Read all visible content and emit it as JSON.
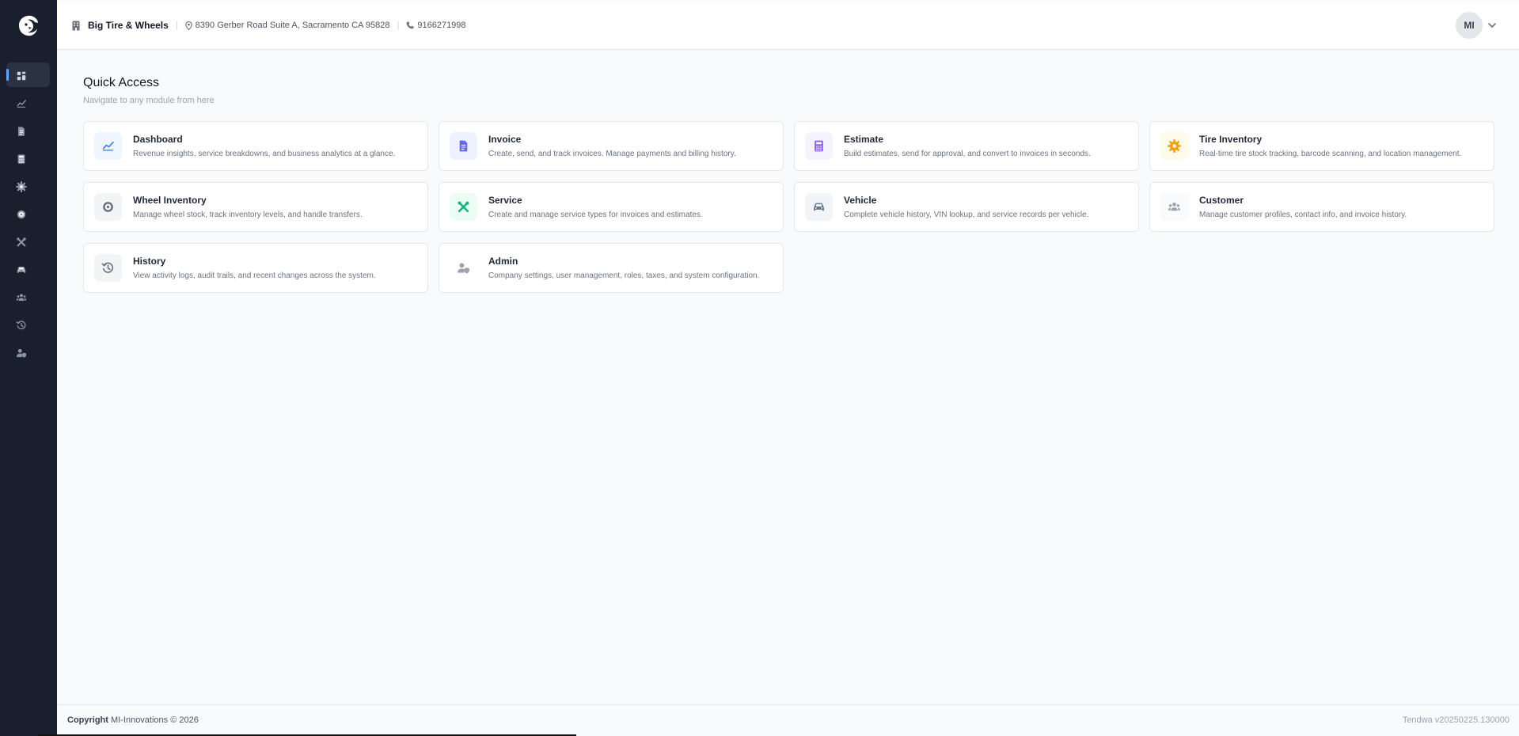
{
  "header": {
    "business_name": "Big Tire & Wheels",
    "address": "8390 Gerber Road Suite A, Sacramento CA 95828",
    "phone": "9166271998",
    "avatar_initials": "MI"
  },
  "sidebar": {
    "items": [
      {
        "name": "dashboard",
        "icon": "grid-icon",
        "active": true
      },
      {
        "name": "analytics",
        "icon": "chart-line-icon"
      },
      {
        "name": "invoice",
        "icon": "document-icon"
      },
      {
        "name": "estimate",
        "icon": "calculator-icon"
      },
      {
        "name": "tire-inventory",
        "icon": "gear-icon"
      },
      {
        "name": "wheel-inventory",
        "icon": "wheel-icon"
      },
      {
        "name": "service",
        "icon": "tools-icon"
      },
      {
        "name": "vehicle",
        "icon": "car-icon"
      },
      {
        "name": "customer",
        "icon": "users-icon"
      },
      {
        "name": "history",
        "icon": "history-icon"
      },
      {
        "name": "admin",
        "icon": "user-shield-icon"
      }
    ]
  },
  "main": {
    "title": "Quick Access",
    "subtitle": "Navigate to any module from here",
    "cards": [
      {
        "title": "Dashboard",
        "desc": "Revenue insights, service breakdowns, and business analytics at a glance.",
        "icon": "chart-line-icon",
        "color": "#3b82f6",
        "bg": "#eff6ff"
      },
      {
        "title": "Invoice",
        "desc": "Create, send, and track invoices. Manage payments and billing history.",
        "icon": "document-icon",
        "color": "#6366f1",
        "bg": "#eef2ff"
      },
      {
        "title": "Estimate",
        "desc": "Build estimates, send for approval, and convert to invoices in seconds.",
        "icon": "calculator-icon",
        "color": "#8b5cf6",
        "bg": "#f5f3ff"
      },
      {
        "title": "Tire Inventory",
        "desc": "Real-time tire stock tracking, barcode scanning, and location management.",
        "icon": "gear-icon",
        "color": "#f59e0b",
        "bg": "#fffbeb"
      },
      {
        "title": "Wheel Inventory",
        "desc": "Manage wheel stock, track inventory levels, and handle transfers.",
        "icon": "wheel-icon",
        "color": "#6b7280",
        "bg": "#f3f4f6"
      },
      {
        "title": "Service",
        "desc": "Create and manage service types for invoices and estimates.",
        "icon": "tools-icon",
        "color": "#10b981",
        "bg": "#ecfdf5"
      },
      {
        "title": "Vehicle",
        "desc": "Complete vehicle history, VIN lookup, and service records per vehicle.",
        "icon": "car-icon",
        "color": "#64748b",
        "bg": "#f1f5f9"
      },
      {
        "title": "Customer",
        "desc": "Manage customer profiles, contact info, and invoice history.",
        "icon": "users-icon",
        "color": "#9ca3af",
        "bg": "#f9fafb"
      },
      {
        "title": "History",
        "desc": "View activity logs, audit trails, and recent changes across the system.",
        "icon": "history-icon",
        "color": "#6b7280",
        "bg": "#f3f4f6"
      },
      {
        "title": "Admin",
        "desc": "Company settings, user management, roles, taxes, and system configuration.",
        "icon": "user-shield-icon",
        "color": "#9ca3af",
        "bg": "#ffffff"
      }
    ]
  },
  "footer": {
    "copyright_label": "Copyright",
    "copyright_text": "MI-Innovations © 2026",
    "version": "Tendwa v20250225.130000"
  }
}
